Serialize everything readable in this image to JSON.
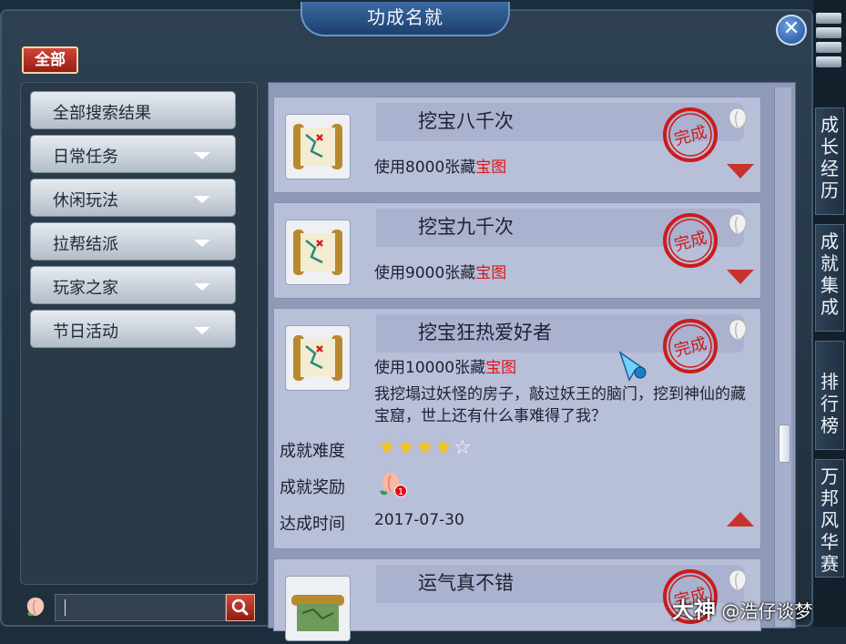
{
  "window": {
    "title": "功成名就",
    "close_glyph": "✕"
  },
  "filter": {
    "all_label": "全部"
  },
  "categories": [
    {
      "label": "全部搜索结果",
      "has_arrow": false
    },
    {
      "label": "日常任务",
      "has_arrow": true
    },
    {
      "label": "休闲玩法",
      "has_arrow": true
    },
    {
      "label": "拉帮结派",
      "has_arrow": true
    },
    {
      "label": "玩家之家",
      "has_arrow": true
    },
    {
      "label": "节日活动",
      "has_arrow": true
    }
  ],
  "search": {
    "value": "",
    "icon": "search-icon"
  },
  "achievements": [
    {
      "title": "挖宝八千次",
      "desc_prefix": "使用8000张藏",
      "desc_highlight": "宝图",
      "stamp": "完成",
      "icon": "treasure-map-scroll-icon",
      "expanded": false
    },
    {
      "title": "挖宝九千次",
      "desc_prefix": "使用9000张藏",
      "desc_highlight": "宝图",
      "stamp": "完成",
      "icon": "treasure-map-scroll-icon",
      "expanded": false
    },
    {
      "title": "挖宝狂热爱好者",
      "desc_prefix": "使用10000张藏",
      "desc_highlight": "宝图",
      "stamp": "完成",
      "icon": "treasure-map-scroll-icon",
      "expanded": true,
      "flavor": "我挖塌过妖怪的房子，敲过妖王的脑门，挖到神仙的藏宝窟，世上还有什么事难得了我？",
      "difficulty_label": "成就难度",
      "difficulty_stars": 4,
      "difficulty_max": 5,
      "reward_label": "成就奖励",
      "reward_count": "1",
      "date_label": "达成时间",
      "date_value": "2017-07-30"
    },
    {
      "title": "运气真不错",
      "stamp": "完成",
      "icon": "map-scroll-icon",
      "expanded": false
    }
  ],
  "side_tabs": [
    "成长经历",
    "成就集成",
    "排行榜",
    "万邦风华赛"
  ],
  "watermark": {
    "brand": "大神",
    "handle": "@浩仔谈梦"
  },
  "colors": {
    "stamp_red": "#cc1b1b",
    "highlight_red": "#e0141a",
    "arrow_red": "#c8332d",
    "panel_lilac": "#b8bfd8"
  }
}
